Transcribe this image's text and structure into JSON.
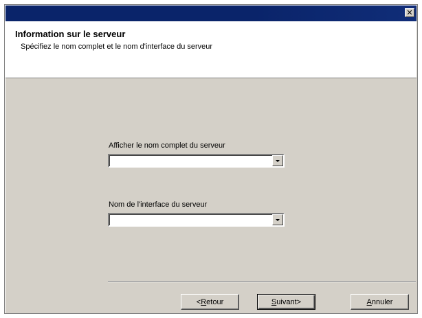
{
  "titlebar": {
    "close_glyph": "✕"
  },
  "header": {
    "title": "Information sur le serveur",
    "description": "Spécifiez le nom complet et le nom d'interface du serveur"
  },
  "form": {
    "full_name_label": "Afficher le nom complet du serveur",
    "full_name_value": "",
    "interface_label": "Nom de l'interface du serveur",
    "interface_value": ""
  },
  "buttons": {
    "back": {
      "prefix": "< ",
      "mnemonic": "R",
      "rest": "etour"
    },
    "next": {
      "mnemonic": "S",
      "rest": "uivant",
      "suffix": " >"
    },
    "cancel": {
      "mnemonic": "A",
      "rest": "nnuler"
    }
  }
}
